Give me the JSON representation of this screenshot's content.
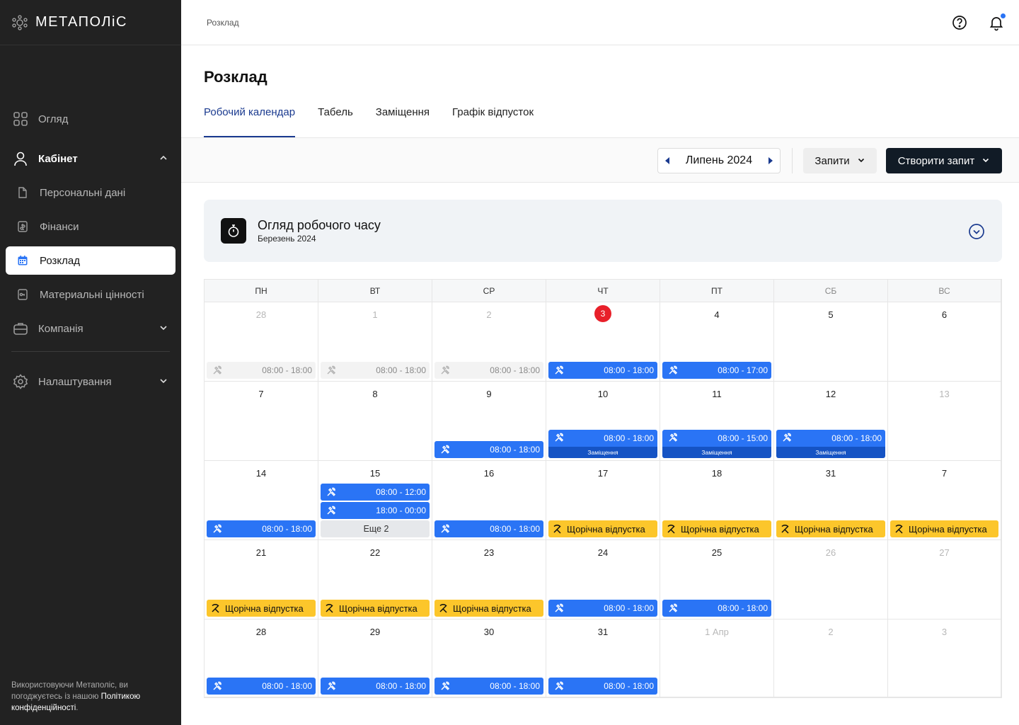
{
  "sidebar": {
    "logo": "МЕТАПОЛіС",
    "items": [
      {
        "label": "Огляд"
      },
      {
        "label": "Кабінет"
      },
      {
        "label": "Персональні дані"
      },
      {
        "label": "Фінанси"
      },
      {
        "label": "Розклад"
      },
      {
        "label": "Материальні цінності"
      },
      {
        "label": "Компанія"
      },
      {
        "label": "Налаштування"
      }
    ],
    "footer_text": "Використовуючи Метаполіс, ви погоджуєтесь із нашою",
    "footer_link": "Політикою конфіденційності",
    "footer_end": "."
  },
  "header": {
    "breadcrumb": "Розклад"
  },
  "page": {
    "title": "Розклад",
    "tabs": [
      "Робочий календар",
      "Табель",
      "Заміщення",
      "Графік відпусток"
    ]
  },
  "toolbar": {
    "month": "Липень 2024",
    "requests_label": "Запити",
    "create_label": "Створити запит"
  },
  "overview": {
    "title": "Огляд робочого часу",
    "subtitle": "Березень 2024"
  },
  "calendar": {
    "weekdays": [
      "ПН",
      "ВТ",
      "СР",
      "ЧТ",
      "ПТ",
      "СБ",
      "ВС"
    ],
    "weeks": [
      [
        {
          "day": "28",
          "muted": true,
          "events": [
            {
              "kind": "ghost",
              "text": "08:00 - 18:00"
            }
          ]
        },
        {
          "day": "1",
          "muted": true,
          "events": [
            {
              "kind": "ghost",
              "text": "08:00 - 18:00"
            }
          ]
        },
        {
          "day": "2",
          "muted": true,
          "events": [
            {
              "kind": "ghost",
              "text": "08:00 - 18:00"
            }
          ]
        },
        {
          "day": "3",
          "today": true,
          "events": [
            {
              "kind": "blue",
              "text": "08:00 - 18:00"
            }
          ]
        },
        {
          "day": "4",
          "events": [
            {
              "kind": "blue",
              "text": "08:00 - 17:00"
            }
          ]
        },
        {
          "day": "5",
          "events": []
        },
        {
          "day": "6",
          "events": []
        }
      ],
      [
        {
          "day": "7",
          "events": []
        },
        {
          "day": "8",
          "events": []
        },
        {
          "day": "9",
          "events": [
            {
              "kind": "blue",
              "text": "08:00 - 18:00"
            }
          ]
        },
        {
          "day": "10",
          "events": [
            {
              "kind": "double",
              "text": "08:00 - 18:00",
              "sub": "Заміщення"
            }
          ]
        },
        {
          "day": "11",
          "events": [
            {
              "kind": "double",
              "text": "08:00 - 15:00",
              "sub": "Заміщення"
            }
          ]
        },
        {
          "day": "12",
          "events": [
            {
              "kind": "double",
              "text": "08:00 - 18:00",
              "sub": "Заміщення"
            }
          ]
        },
        {
          "day": "13",
          "muted": true,
          "events": []
        }
      ],
      [
        {
          "day": "14",
          "events": [
            {
              "kind": "blue",
              "text": "08:00 - 18:00"
            }
          ]
        },
        {
          "day": "15",
          "events": [
            {
              "kind": "blue",
              "text": "08:00 - 12:00"
            },
            {
              "kind": "blue",
              "text": "18:00 - 00:00"
            },
            {
              "kind": "more",
              "text": "Еще 2"
            }
          ]
        },
        {
          "day": "16",
          "events": [
            {
              "kind": "blue",
              "text": "08:00 - 18:00"
            }
          ]
        },
        {
          "day": "17",
          "events": [
            {
              "kind": "yellow",
              "text": "Щорічна відпустка"
            }
          ]
        },
        {
          "day": "18",
          "events": [
            {
              "kind": "yellow",
              "text": "Щорічна відпустка"
            }
          ]
        },
        {
          "day": "31",
          "events": [
            {
              "kind": "yellow",
              "text": "Щорічна відпустка"
            }
          ]
        },
        {
          "day": "7",
          "events": [
            {
              "kind": "yellow",
              "text": "Щорічна відпустка"
            }
          ]
        }
      ],
      [
        {
          "day": "21",
          "events": [
            {
              "kind": "yellow",
              "text": "Щорічна відпустка"
            }
          ]
        },
        {
          "day": "22",
          "events": [
            {
              "kind": "yellow",
              "text": "Щорічна відпустка"
            }
          ]
        },
        {
          "day": "23",
          "events": [
            {
              "kind": "yellow",
              "text": "Щорічна відпустка"
            }
          ]
        },
        {
          "day": "24",
          "events": [
            {
              "kind": "blue",
              "text": "08:00 - 18:00"
            }
          ]
        },
        {
          "day": "25",
          "events": [
            {
              "kind": "blue",
              "text": "08:00 - 18:00"
            }
          ]
        },
        {
          "day": "26",
          "muted": true,
          "events": []
        },
        {
          "day": "27",
          "muted": true,
          "events": []
        }
      ],
      [
        {
          "day": "28",
          "events": [
            {
              "kind": "blue",
              "text": "08:00 - 18:00"
            }
          ]
        },
        {
          "day": "29",
          "events": [
            {
              "kind": "blue",
              "text": "08:00 - 18:00"
            }
          ]
        },
        {
          "day": "30",
          "events": [
            {
              "kind": "blue",
              "text": "08:00 - 18:00"
            }
          ]
        },
        {
          "day": "31",
          "events": [
            {
              "kind": "blue",
              "text": "08:00 - 18:00"
            }
          ]
        },
        {
          "day": "1 Апр",
          "muted": true,
          "events": []
        },
        {
          "day": "2",
          "muted": true,
          "events": []
        },
        {
          "day": "3",
          "muted": true,
          "events": []
        }
      ]
    ]
  },
  "colors": {
    "sidebar_bg": "#222222",
    "accent_blue": "#2a74f5",
    "substitution_blue": "#1553c4",
    "vacation_yellow": "#fcc62b",
    "today_red": "#e8202a",
    "primary_button": "#111b26",
    "tab_active": "#1a3a8f"
  },
  "icons": {
    "work_shift": "hammer-wrench-icon",
    "vacation": "beach-icon",
    "help": "help-circle-icon",
    "notifications": "bell-icon",
    "timer": "stopwatch-icon"
  }
}
